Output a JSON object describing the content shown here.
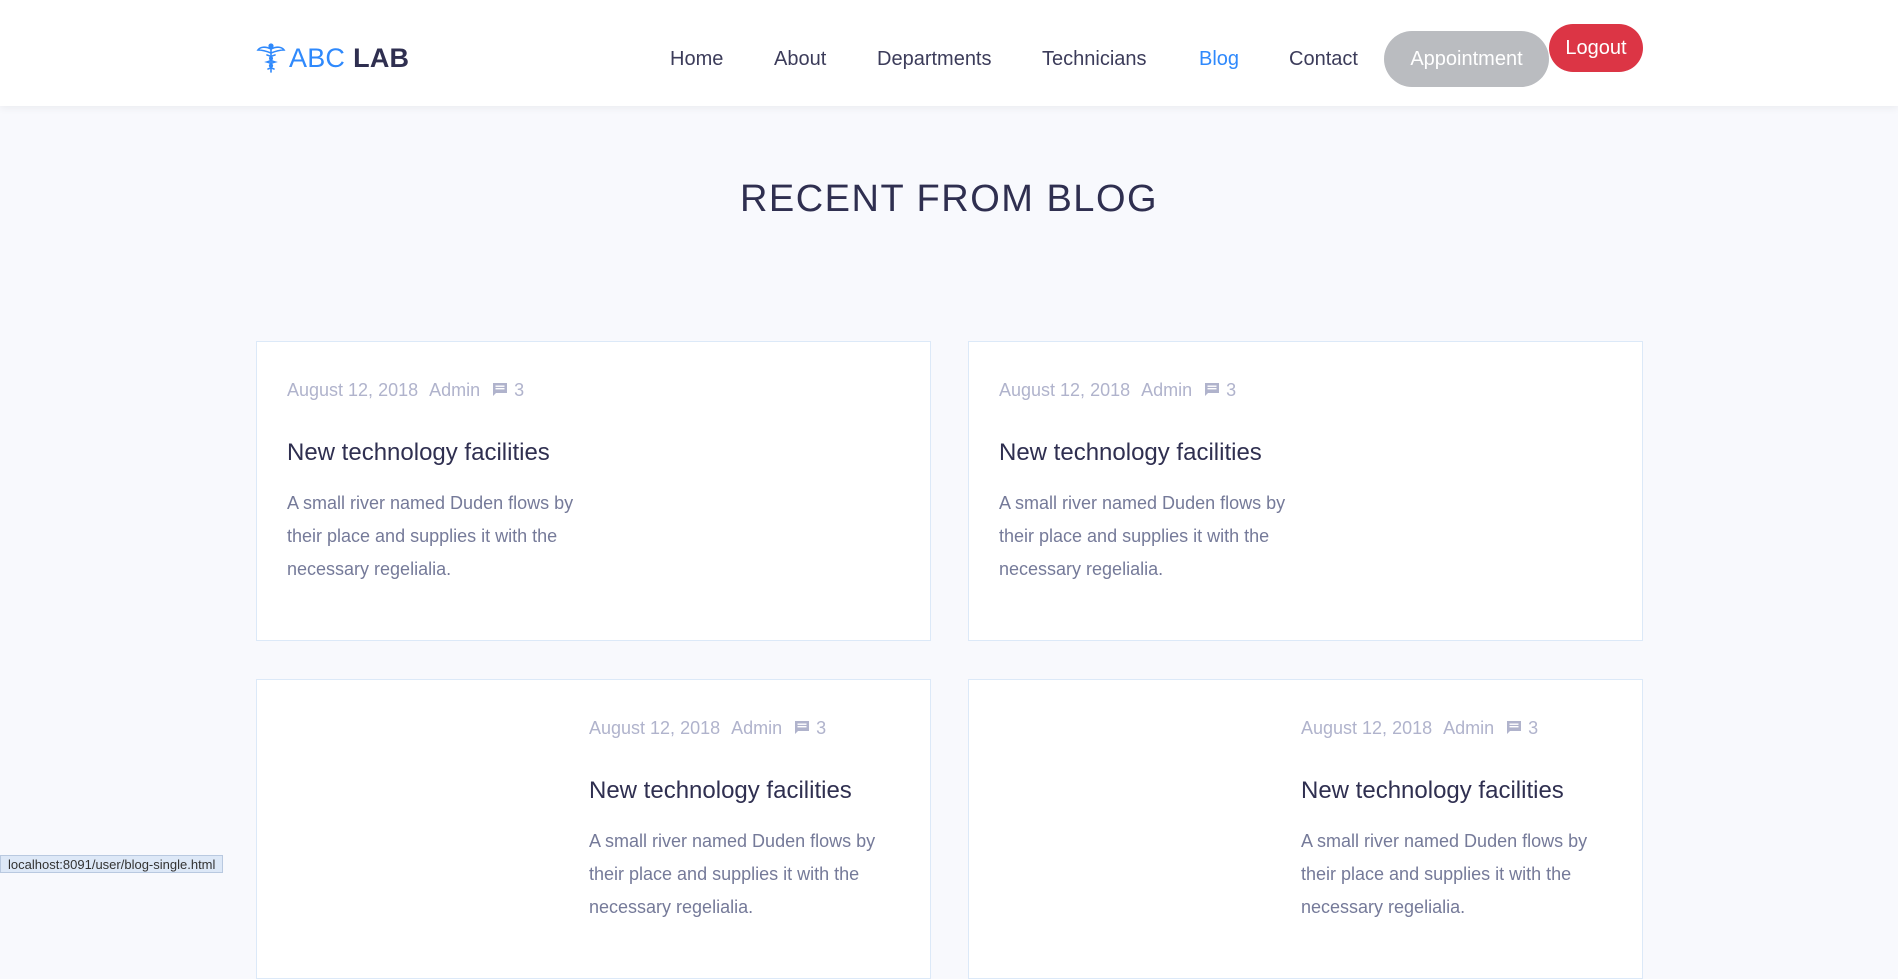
{
  "brand": {
    "part1": "ABC",
    "part2": "LAB",
    "icon": "caduceus-icon",
    "color": "#2f89fc"
  },
  "nav": {
    "items": [
      {
        "label": "Home",
        "active": false
      },
      {
        "label": "About",
        "active": false
      },
      {
        "label": "Departments",
        "active": false
      },
      {
        "label": "Technicians",
        "active": false
      },
      {
        "label": "Blog",
        "active": true
      },
      {
        "label": "Contact",
        "active": false
      }
    ],
    "appointment_label": "Appointment",
    "logout_label": "Logout"
  },
  "section": {
    "title": "RECENT FROM BLOG"
  },
  "posts": [
    {
      "date": "August 12, 2018",
      "author": "Admin",
      "comments": "3",
      "title": "New technology facilities",
      "excerpt": "A small river named Duden flows by their place and supplies it with the necessary regelialia."
    },
    {
      "date": "August 12, 2018",
      "author": "Admin",
      "comments": "3",
      "title": "New technology facilities",
      "excerpt": "A small river named Duden flows by their place and supplies it with the necessary regelialia."
    },
    {
      "date": "August 12, 2018",
      "author": "Admin",
      "comments": "3",
      "title": "New technology facilities",
      "excerpt": "A small river named Duden flows by their place and supplies it with the necessary regelialia."
    },
    {
      "date": "August 12, 2018",
      "author": "Admin",
      "comments": "3",
      "title": "New technology facilities",
      "excerpt": "A small river named Duden flows by their place and supplies it with the necessary regelialia."
    }
  ],
  "status_bar": {
    "url": "localhost:8091/user/blog-single.html"
  },
  "colors": {
    "accent": "#2f89fc",
    "logout": "#dc3545",
    "appointment": "#babcc0"
  }
}
